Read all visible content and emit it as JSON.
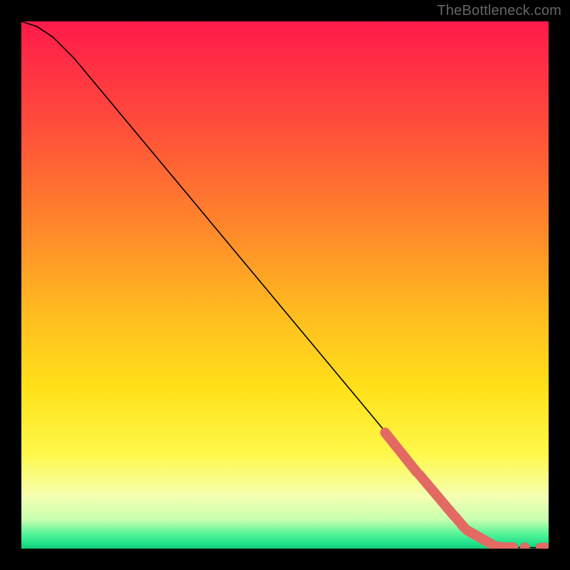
{
  "watermark": "TheBottleneck.com",
  "chart_data": {
    "type": "line",
    "title": "",
    "xlabel": "",
    "ylabel": "",
    "xlim": [
      0,
      100
    ],
    "ylim": [
      0,
      100
    ],
    "series": [
      {
        "name": "curve",
        "x": [
          0,
          3,
          6,
          10,
          15,
          25,
          40,
          55,
          70,
          80,
          85,
          88,
          90,
          95,
          100
        ],
        "y": [
          100,
          99,
          97,
          93,
          87,
          75,
          57,
          39,
          21,
          9,
          3,
          1.2,
          0.4,
          0.2,
          0.2
        ]
      }
    ],
    "highlight_segments": [
      {
        "name": "cluster-1",
        "x": [
          69,
          75
        ],
        "y": [
          22,
          14.5
        ]
      },
      {
        "name": "cluster-2",
        "x": [
          75.5,
          82
        ],
        "y": [
          14,
          6.3
        ]
      },
      {
        "name": "cluster-3",
        "x": [
          82.3,
          84
        ],
        "y": [
          6,
          4
        ]
      },
      {
        "name": "cluster-4",
        "x": [
          84.5,
          90
        ],
        "y": [
          3.5,
          0.4
        ]
      }
    ],
    "highlight_points": [
      {
        "x": 90.7,
        "y": 0.35
      },
      {
        "x": 91.6,
        "y": 0.3
      },
      {
        "x": 92.5,
        "y": 0.28
      },
      {
        "x": 93.3,
        "y": 0.25
      },
      {
        "x": 95.5,
        "y": 0.22
      },
      {
        "x": 98.5,
        "y": 0.2
      },
      {
        "x": 99.3,
        "y": 0.2
      }
    ],
    "gradient_stops": [
      {
        "offset": 0.0,
        "color": "#ff1a4b"
      },
      {
        "offset": 0.2,
        "color": "#ff4e3a"
      },
      {
        "offset": 0.4,
        "color": "#ff8a2a"
      },
      {
        "offset": 0.55,
        "color": "#ffbb1f"
      },
      {
        "offset": 0.7,
        "color": "#ffe21a"
      },
      {
        "offset": 0.82,
        "color": "#fff84a"
      },
      {
        "offset": 0.9,
        "color": "#f6ffb0"
      },
      {
        "offset": 0.945,
        "color": "#c8ffb0"
      },
      {
        "offset": 0.97,
        "color": "#5ef59a"
      },
      {
        "offset": 0.99,
        "color": "#1fe28a"
      },
      {
        "offset": 1.0,
        "color": "#12c977"
      }
    ],
    "marker_color": "#e26a63",
    "marker_radius": 7,
    "line_color": "#000000",
    "line_width": 1.6
  }
}
